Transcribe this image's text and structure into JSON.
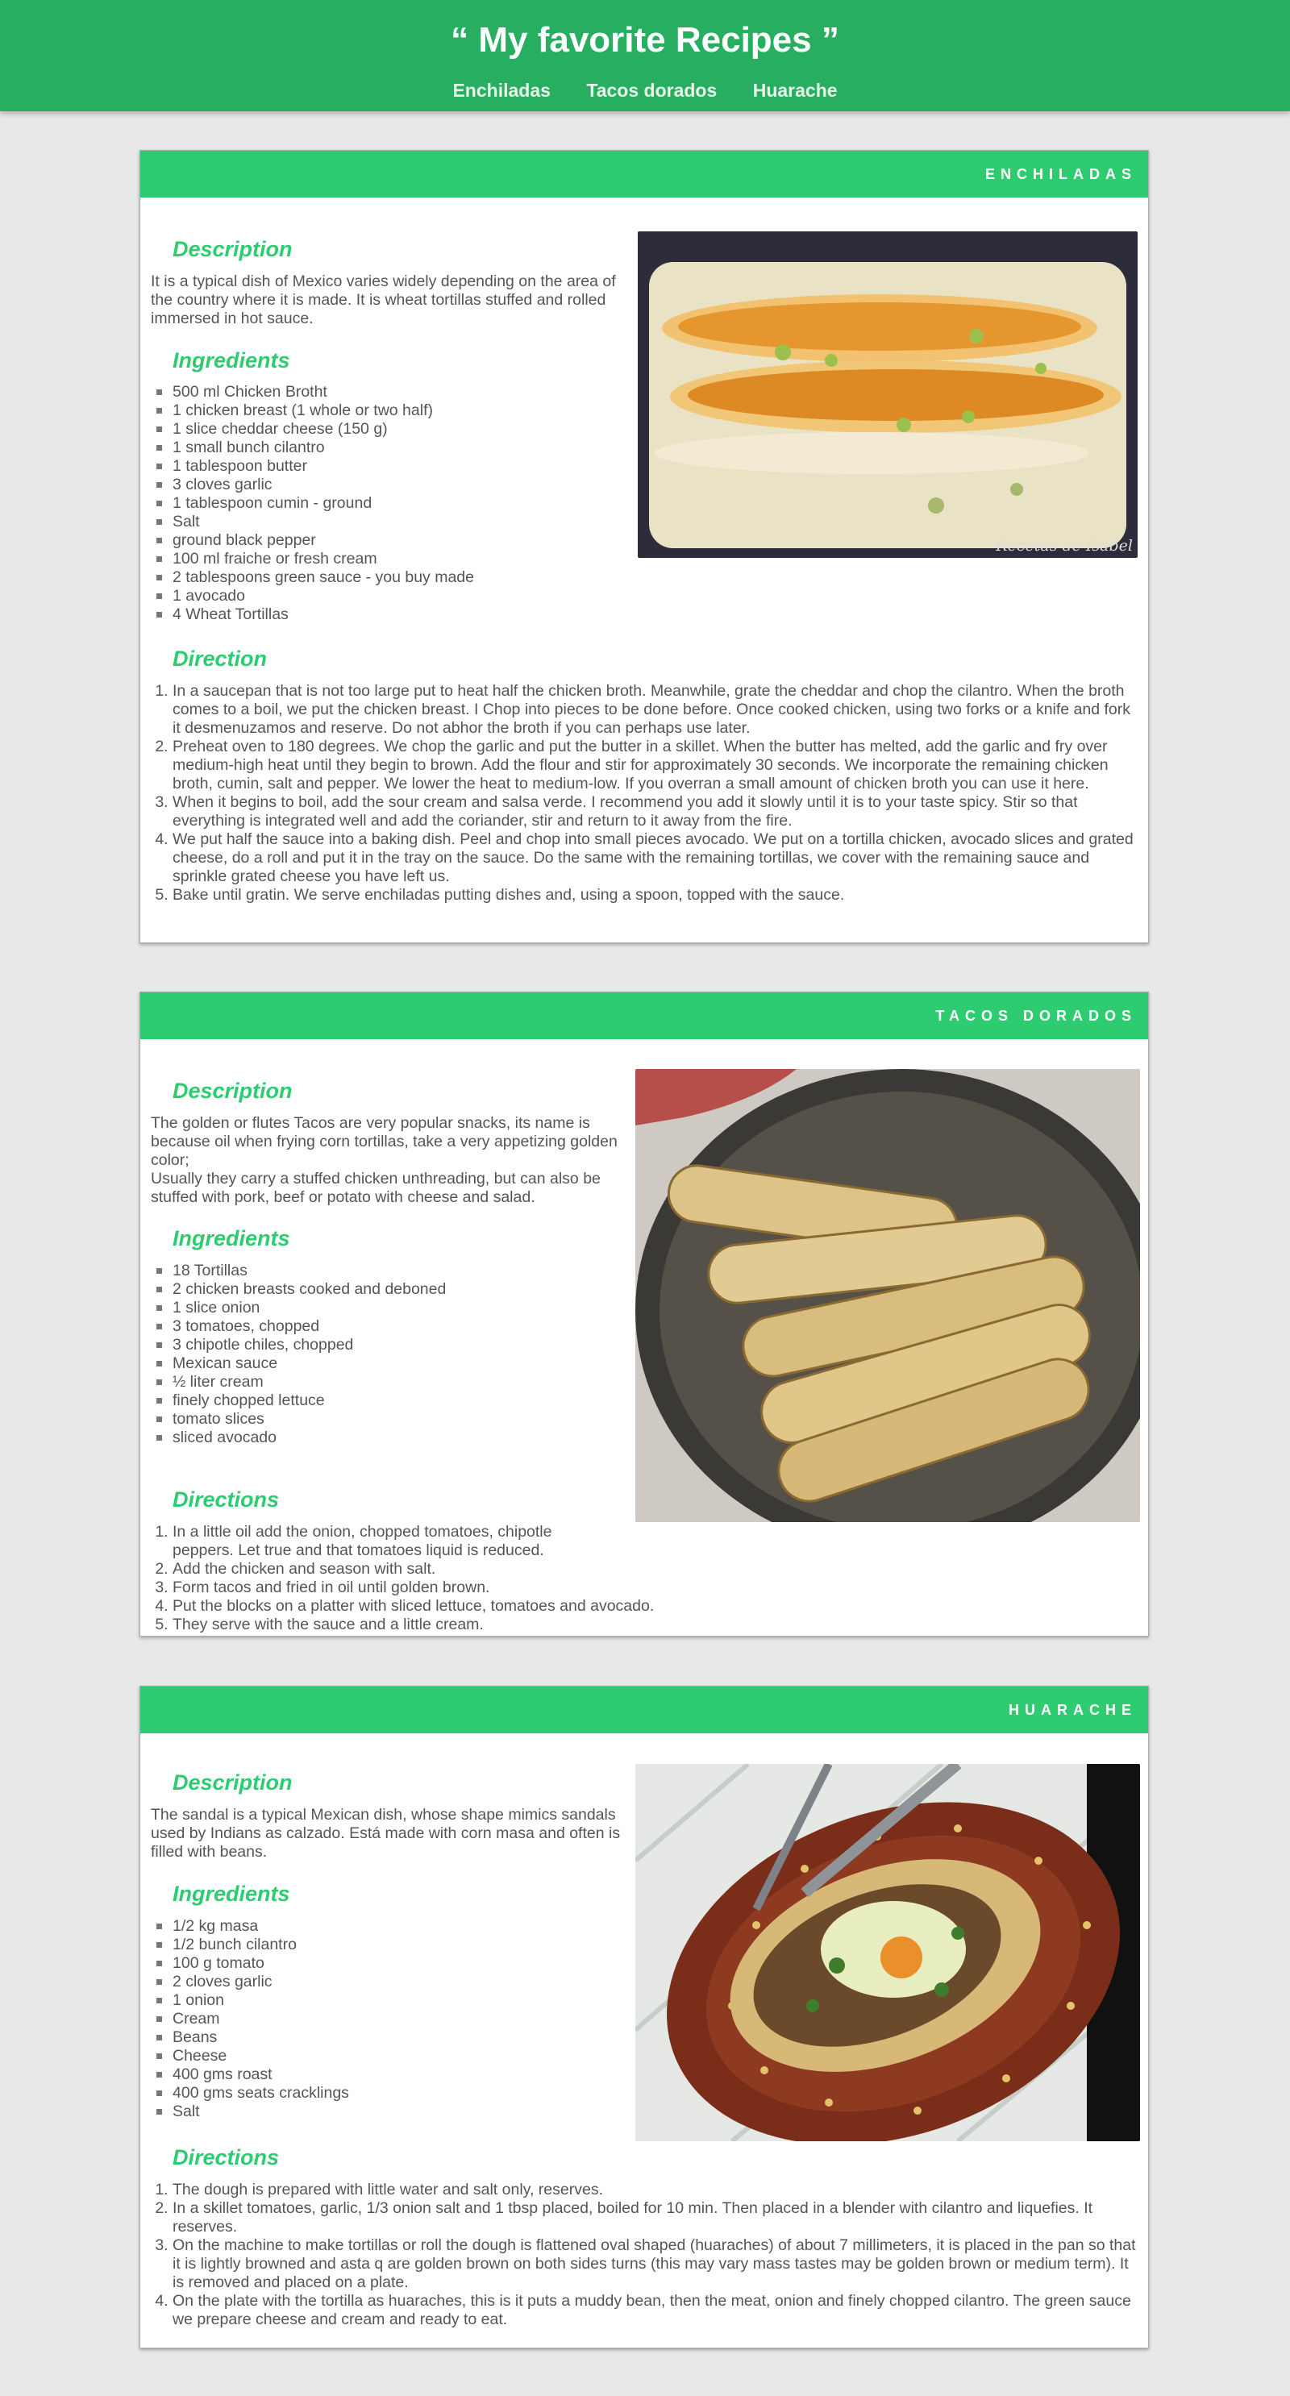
{
  "site": {
    "title": "“ My favorite Recipes ”",
    "nav": [
      "Enchiladas",
      "Tacos dorados",
      "Huarache"
    ]
  },
  "colors": {
    "header": "#27ae60",
    "card_header": "#2ecc71",
    "accent": "#2ecc71"
  },
  "recipes": [
    {
      "header": "ENCHILADAS",
      "image_label": "Recetas de Isabel",
      "description_heading": "Description",
      "description": [
        "It is a typical dish of Mexico varies widely depending on the area of the country where it is made. It is wheat tortillas stuffed and rolled immersed in hot sauce."
      ],
      "ingredients_heading": "Ingredients",
      "ingredients": [
        "500 ml Chicken Brotht",
        "1 chicken breast (1 whole or two half)",
        "1 slice cheddar cheese (150 g)",
        "1 small bunch cilantro",
        "1 tablespoon butter",
        "3 cloves garlic",
        "1 tablespoon cumin - ground",
        "Salt",
        "ground black pepper",
        "100 ml fraiche or fresh cream",
        "2 tablespoons green sauce - you buy made",
        "1 avocado",
        "4 Wheat Tortillas"
      ],
      "directions_heading": "Direction",
      "directions": [
        "In a saucepan that is not too large put to heat half the chicken broth. Meanwhile, grate the cheddar and chop the cilantro. When the broth comes to a boil, we put the chicken breast. I Chop into pieces to be done before. Once cooked chicken, using two forks or a knife and fork it desmenuzamos and reserve. Do not abhor the broth if you can perhaps use later.",
        "Preheat oven to 180 degrees. We chop the garlic and put the butter in a skillet. When the butter has melted, add the garlic and fry over medium-high heat until they begin to brown. Add the flour and stir for approximately 30 seconds. We incorporate the remaining chicken broth, cumin, salt and pepper. We lower the heat to medium-low. If you overran a small amount of chicken broth you can use it here.",
        "When it begins to boil, add the sour cream and salsa verde. I recommend you add it slowly until it is to your taste spicy. Stir so that everything is integrated well and add the coriander, stir and return to it away from the fire.",
        "We put half the sauce into a baking dish. Peel and chop into small pieces avocado. We put on a tortilla chicken, avocado slices and grated cheese, do a roll and put it in the tray on the sauce. Do the same with the remaining tortillas, we cover with the remaining sauce and sprinkle grated cheese you have left us.",
        "Bake until gratin. We serve enchiladas putting dishes and, using a spoon, topped with the sauce."
      ]
    },
    {
      "header": "TACOS DORADOS",
      "description_heading": "Description",
      "description": [
        "The golden or flutes Tacos are very popular snacks, its name is because oil when frying corn tortillas, take a very appetizing golden color;",
        "Usually they carry a stuffed chicken unthreading, but can also be stuffed with pork, beef or potato with cheese and salad."
      ],
      "ingredients_heading": "Ingredients",
      "ingredients": [
        "18 Tortillas",
        "2 chicken breasts cooked and deboned",
        "1 slice onion",
        "3 tomatoes, chopped",
        "3 chipotle chiles, chopped",
        "Mexican sauce",
        "½ liter cream",
        "finely chopped lettuce",
        "tomato slices",
        "sliced avocado"
      ],
      "directions_heading": "Directions",
      "directions": [
        "In a little oil add the onion, chopped tomatoes, chipotle peppers. Let true and that tomatoes liquid is reduced.",
        "Add the chicken and season with salt.",
        "Form tacos and fried in oil until golden brown.",
        "Put the blocks on a platter with sliced lettuce, tomatoes and avocado.",
        "They serve with the sauce and a little cream."
      ]
    },
    {
      "header": "HUARACHE",
      "description_heading": "Description",
      "description": [
        "The sandal is a typical Mexican dish, whose shape mimics sandals used by Indians as calzado. Está made with corn masa and often is filled with beans."
      ],
      "ingredients_heading": "Ingredients",
      "ingredients": [
        "1/2 kg masa",
        "1/2 bunch cilantro",
        "100 g tomato",
        "2 cloves garlic",
        "1 onion",
        "Cream",
        "Beans",
        "Cheese",
        "400 gms roast",
        "400 gms seats cracklings",
        "Salt"
      ],
      "directions_heading": "Directions",
      "directions": [
        "The dough is prepared with little water and salt only, reserves.",
        "In a skillet tomatoes, garlic, 1/3 onion salt and 1 tbsp placed, boiled for 10 min. Then placed in a blender with cilantro and liquefies. It reserves.",
        "On the machine to make tortillas or roll the dough is flattened oval shaped (huaraches) of about 7 millimeters, it is placed in the pan so that it is lightly browned and asta q are golden brown on both sides turns (this may vary mass tastes may be golden brown or medium term). It is removed and placed on a plate.",
        "On the plate with the tortilla as huaraches, this is it puts a muddy bean, then the meat, onion and finely chopped cilantro. The green sauce we prepare cheese and cream and ready to eat."
      ]
    }
  ]
}
